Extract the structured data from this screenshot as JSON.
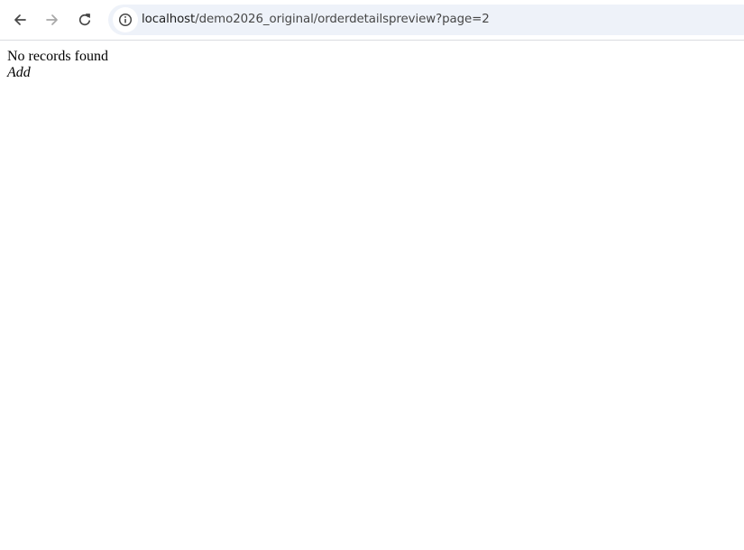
{
  "browser": {
    "url_host": "localhost",
    "url_path": "/demo2026_original/orderdetailspreview?page=2",
    "icons": {
      "back": "arrow-left-icon",
      "forward": "arrow-right-icon",
      "reload": "reload-icon",
      "site_info": "info-icon"
    },
    "colors": {
      "omnibox_bg": "#eef2f9",
      "icon_active": "#474747",
      "icon_disabled": "#a8a8a8"
    }
  },
  "page": {
    "message": "No records found",
    "add_label": "Add"
  }
}
